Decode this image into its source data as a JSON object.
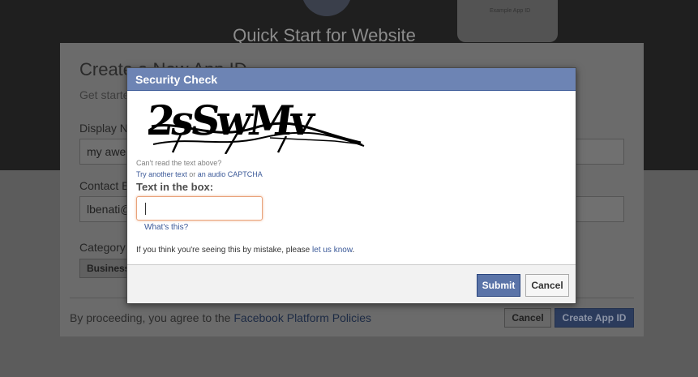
{
  "background": {
    "title": "Quick Start for Website",
    "phone_text": "Example App ID"
  },
  "app_dialog": {
    "heading": "Create a New App ID",
    "subheading": "Get started",
    "display_name_label": "Display N",
    "display_name_value": "my awe",
    "contact_email_label": "Contact E",
    "contact_email_value": "lbenati@",
    "category_label": "Category",
    "category_value": "Business",
    "agreement_prefix": "By proceeding, you agree to the",
    "agreement_link": "Facebook Platform Policies",
    "cancel_label": "Cancel",
    "create_label": "Create App ID"
  },
  "security_check": {
    "title": "Security Check",
    "captcha_text": "2sSwMv",
    "cant_read": "Can't read the text above?",
    "try_another_link": "Try another text",
    "or_text": " or ",
    "audio_link": "an audio CAPTCHA",
    "text_in_box_label": "Text in the box:",
    "input_value": "",
    "whats_this": "What's this?",
    "mistake_text": "If you think you're seeing this by mistake, please ",
    "let_us_know": "let us know",
    "mistake_suffix": ".",
    "submit_label": "Submit",
    "cancel_label": "Cancel"
  },
  "colors": {
    "header_blue": "#6d84b4",
    "submit_blue": "#5b74a8",
    "link_blue": "#3b5998",
    "input_focus": "#e9a27a"
  }
}
